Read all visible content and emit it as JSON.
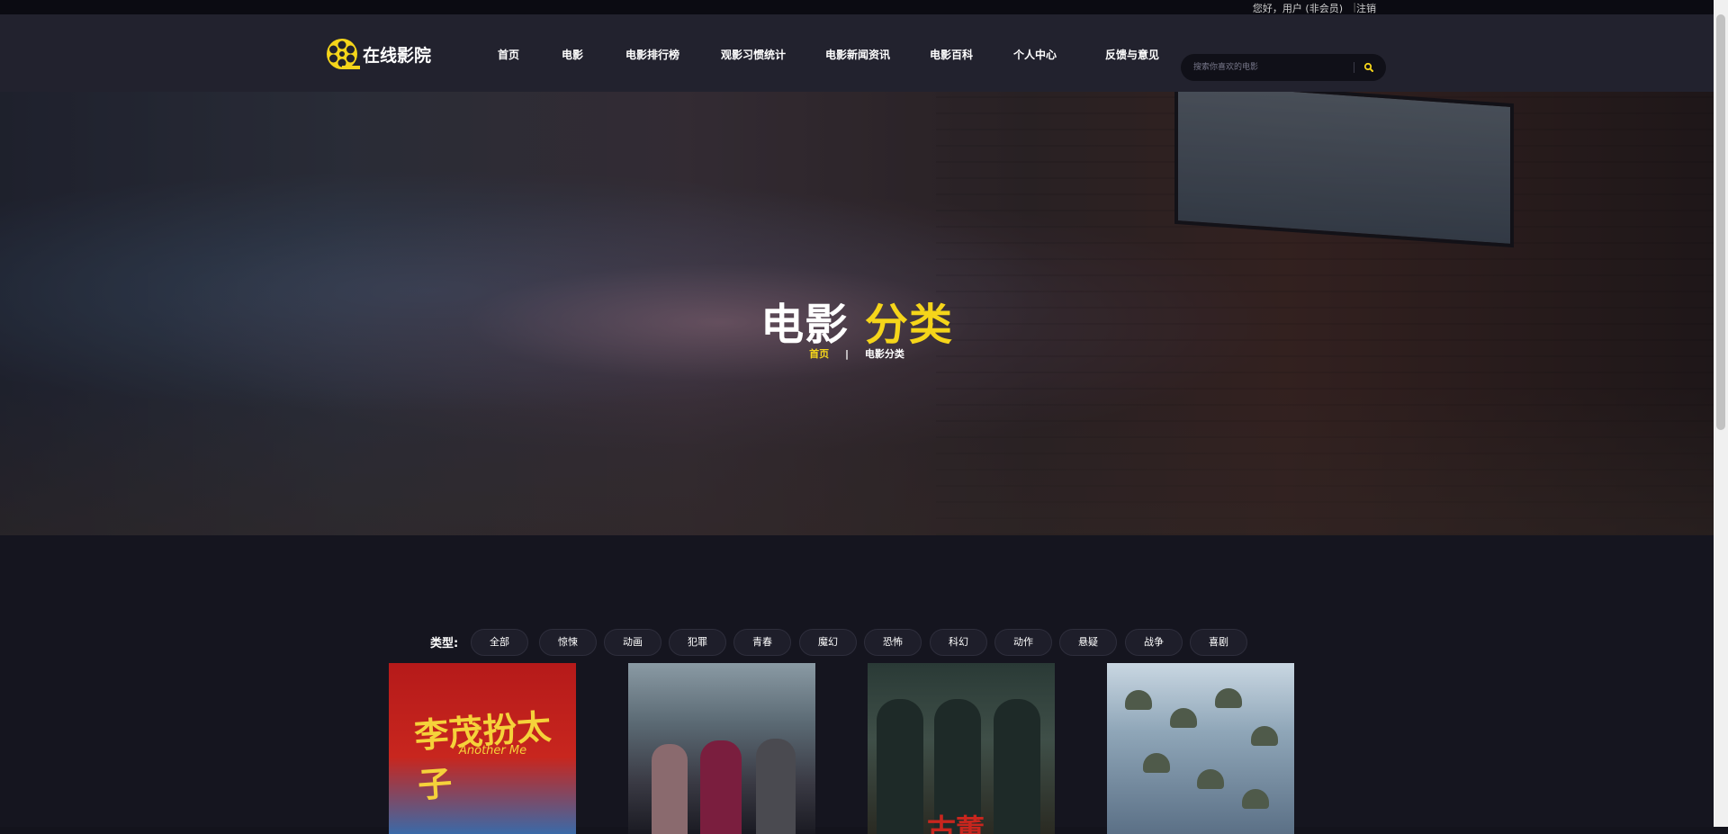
{
  "topbar": {
    "greeting": "您好，用户 (非会员)",
    "separator": "|",
    "logout": "注销"
  },
  "nav": {
    "logo_text": "在线影院",
    "menu": [
      {
        "label": "首页"
      },
      {
        "label": "电影"
      },
      {
        "label": "电影排行榜"
      },
      {
        "label": "观影习惯统计"
      },
      {
        "label": "电影新闻资讯"
      },
      {
        "label": "电影百科"
      },
      {
        "label": "个人中心"
      },
      {
        "label": "反馈与意见"
      }
    ],
    "search_placeholder": "搜索你喜欢的电影",
    "search_icon": "search-icon"
  },
  "hero": {
    "title_white": "电影",
    "title_yellow": "分类",
    "breadcrumb_home": "首页",
    "breadcrumb_sep": "|",
    "breadcrumb_current": "电影分类"
  },
  "filter": {
    "label": "类型:",
    "types": [
      "全部",
      "惊悚",
      "动画",
      "犯罪",
      "青春",
      "魔幻",
      "恐怖",
      "科幻",
      "动作",
      "悬疑",
      "战争",
      "喜剧"
    ]
  },
  "posters": {
    "p1_title": "李茂扮太子",
    "p1_sub": "Another Me",
    "p3_title": "古董"
  },
  "colors": {
    "accent": "#f5d51a",
    "nav_bg": "#22222e",
    "page_bg": "#15151f"
  }
}
